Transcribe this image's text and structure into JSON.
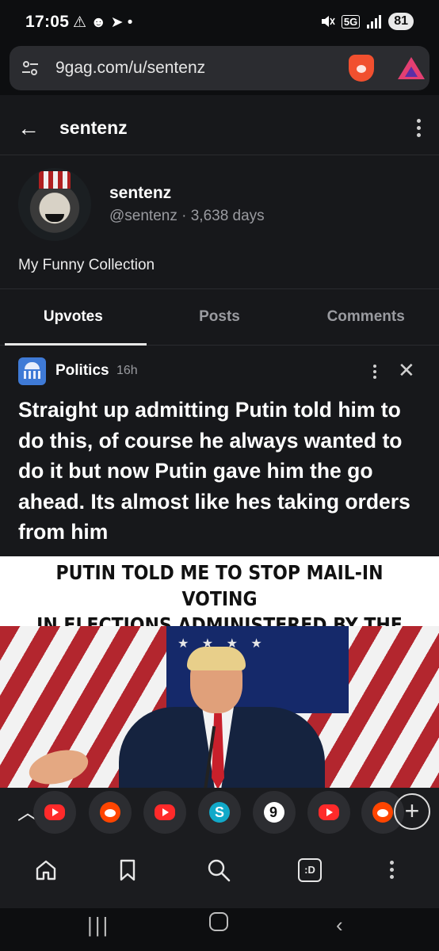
{
  "status_bar": {
    "time": "17:05",
    "left_icons": "⚠ ☻ ➤ •",
    "battery": "81",
    "network": "5G"
  },
  "browser": {
    "url": "9gag.com/u/sentenz"
  },
  "header": {
    "title": "sentenz"
  },
  "profile": {
    "name": "sentenz",
    "meta": "@sentenz · 3,638 days",
    "bio": "My Funny Collection"
  },
  "tabs": [
    {
      "label": "Upvotes"
    },
    {
      "label": "Posts"
    },
    {
      "label": "Comments"
    }
  ],
  "post": {
    "category": "Politics",
    "time": "16h",
    "title": "Straight up admitting Putin told him to do this, of course he always wanted to do it but now Putin gave him the go ahead. Its almost like hes taking orders from him",
    "image_caption_line1": "PUTIN TOLD ME TO STOP MAIL-IN VOTING",
    "image_caption_line2": "IN ELECTIONS ADMINISTERED BY THE STATES"
  },
  "tab_strip": {
    "icons": [
      "youtube-icon",
      "reddit-icon",
      "youtube-icon",
      "s-app-icon",
      "9gag-icon",
      "youtube-icon",
      "reddit-icon"
    ]
  },
  "bottom_nav": {
    "icons": [
      "home-icon",
      "bookmark-icon",
      "search-icon",
      "tabs-icon",
      "menu-icon"
    ],
    "tabs_label": ":D"
  },
  "colors": {
    "background": "#17181b",
    "accent_brave": "#f1502f",
    "politics_icon": "#3f7ad6"
  }
}
